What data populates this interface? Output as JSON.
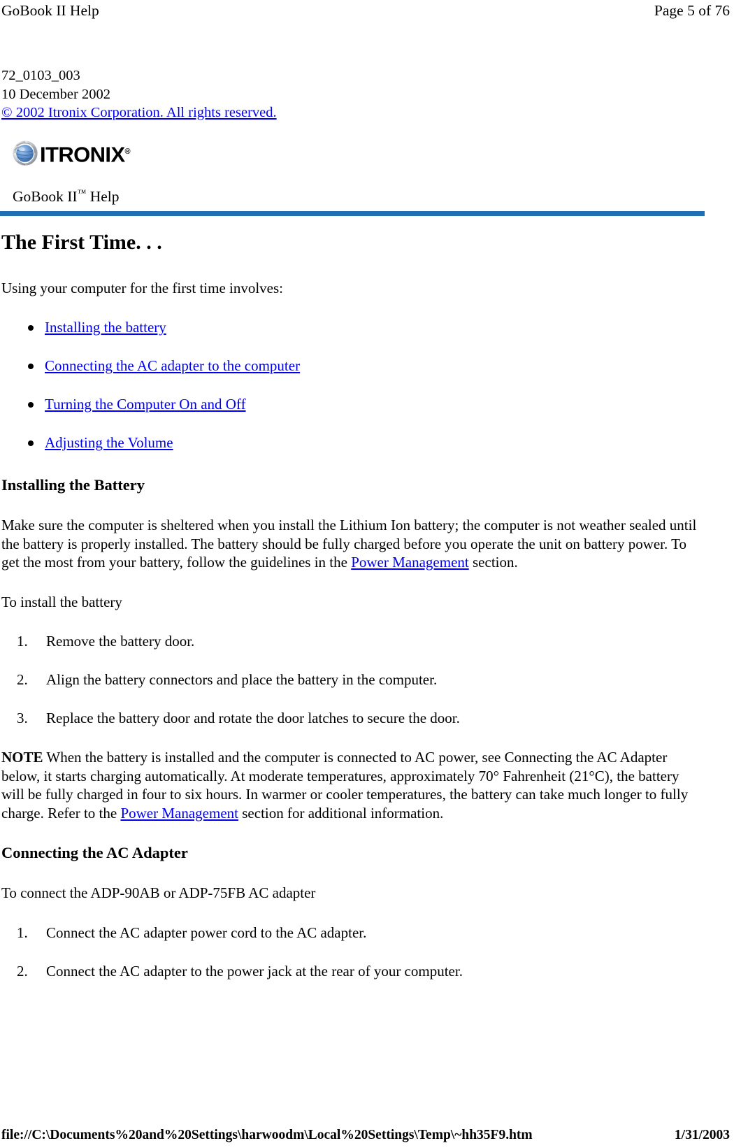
{
  "print_header": {
    "left": "GoBook II Help",
    "right": "Page 5 of 76"
  },
  "doc_info": {
    "doc_number": "72_0103_003",
    "date": "10 December 2002",
    "copyright_link": "© 2002 Itronix Corporation.  All rights reserved."
  },
  "branding": {
    "logo_wordmark": "ITRONIX",
    "logo_registered_mark": "®",
    "product_title_prefix": "GoBook II",
    "product_title_tm": "™",
    "product_title_suffix": " Help",
    "rule_color": "#1f6fb5",
    "globe_blue": "#5b8fd0",
    "globe_silver": "#c8cbd0"
  },
  "content": {
    "title": "The First Time. . .",
    "intro": "Using your computer for the first time involves:",
    "bullets": [
      {
        "label": "Installing the battery"
      },
      {
        "label": "Connecting the AC adapter to the computer"
      },
      {
        "label": "Turning the Computer On and Off"
      },
      {
        "label": "Adjusting the Volume"
      }
    ],
    "battery_section": {
      "heading": "Installing the Battery",
      "paragraph_part1": "Make sure the computer is sheltered when you install the Lithium Ion battery; the computer is not weather sealed until the battery is properly installed. The battery should be fully charged before you operate the unit on battery power. To get the most from your battery, follow the guidelines in the ",
      "paragraph_link": "Power Management",
      "paragraph_part2": " section.",
      "lead_in": "To install the battery",
      "steps": [
        {
          "num": "1.",
          "text": "Remove the battery door."
        },
        {
          "num": "2.",
          "text": "Align the battery connectors and place the battery in the computer."
        },
        {
          "num": "3.",
          "text": "Replace the battery door and rotate the door latches to secure the door."
        }
      ],
      "note_label": "NOTE",
      "note_part1": "  When the battery is installed and the computer is connected to AC power, see Connecting the AC Adapter below, it starts charging automatically.  At moderate temperatures, approximately 70° Fahrenheit (21°C), the battery will be fully charged in four to six hours. In warmer or cooler temperatures, the battery can take much longer to fully charge.  Refer to the ",
      "note_link": "Power Management",
      "note_part2": " section for additional information."
    },
    "adapter_section": {
      "heading": "Connecting the AC Adapter",
      "lead_in": "To connect the ADP-90AB or ADP-75FB AC adapter",
      "steps": [
        {
          "num": "1.",
          "text": "Connect the AC adapter power cord to the AC adapter."
        },
        {
          "num": "2.",
          "text": "Connect the AC adapter to the power jack at the rear of your computer."
        }
      ]
    }
  },
  "print_footer": {
    "path": "file://C:\\Documents%20and%20Settings\\harwoodm\\Local%20Settings\\Temp\\~hh35F9.htm",
    "date": "1/31/2003"
  }
}
